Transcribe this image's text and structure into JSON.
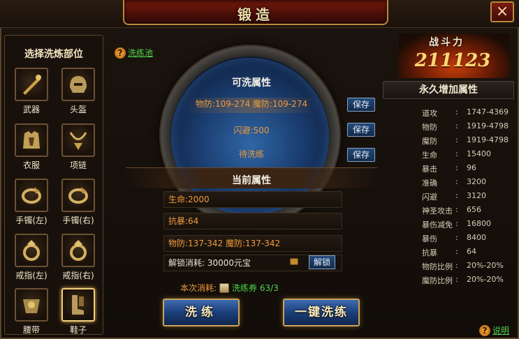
{
  "window": {
    "title": "锻造",
    "close_icon": "×"
  },
  "left_panel": {
    "title": "选择洗炼部位",
    "slots": [
      {
        "label": "武器",
        "icon": "weapon-icon"
      },
      {
        "label": "头盔",
        "icon": "helmet-icon"
      },
      {
        "label": "衣服",
        "icon": "armor-icon"
      },
      {
        "label": "项链",
        "icon": "necklace-icon"
      },
      {
        "label": "手镯(左)",
        "icon": "bracelet-icon"
      },
      {
        "label": "手镯(右)",
        "icon": "bracelet-icon"
      },
      {
        "label": "戒指(左)",
        "icon": "ring-icon"
      },
      {
        "label": "戒指(右)",
        "icon": "ring-icon"
      },
      {
        "label": "腰带",
        "icon": "belt-icon"
      },
      {
        "label": "鞋子",
        "icon": "boots-icon",
        "selected": true
      }
    ]
  },
  "help_pool": {
    "q": "?",
    "label": "洗练池"
  },
  "washable": {
    "title": "可洗属性",
    "rows": [
      {
        "text": "物防:109-274 魔防:109-274",
        "save": "保存"
      },
      {
        "text": "闪避:500",
        "save": "保存"
      },
      {
        "text": "待洗练",
        "save": "保存"
      }
    ]
  },
  "current": {
    "title": "当前属性",
    "rows": [
      "生命:2000",
      "抗暴:64",
      "物防:137-342 魔防:137-342"
    ],
    "unlock_text": "解锁消耗: 30000元宝",
    "unlock_button": "解锁"
  },
  "cost": {
    "label": "本次消耗:",
    "item": "洗练券 63/3"
  },
  "buttons": {
    "wash": "洗练",
    "one_click": "一键洗练"
  },
  "power": {
    "label": "战斗力",
    "value": "211123"
  },
  "permanent": {
    "title": "永久增加属性",
    "stats": [
      {
        "name": "道攻",
        "value": "1747-4369"
      },
      {
        "name": "物防",
        "value": "1919-4798"
      },
      {
        "name": "魔防",
        "value": "1919-4798"
      },
      {
        "name": "生命",
        "value": "15400"
      },
      {
        "name": "暴击",
        "value": "96"
      },
      {
        "name": "准确",
        "value": "3200"
      },
      {
        "name": "闪避",
        "value": "3120"
      },
      {
        "name": "神圣攻击",
        "value": "656"
      },
      {
        "name": "暴伤减免",
        "value": "16800"
      },
      {
        "name": "暴伤",
        "value": "8400"
      },
      {
        "name": "抗暴",
        "value": "64"
      },
      {
        "name": "物防比例",
        "value": "20%-20%"
      },
      {
        "name": "魔防比例",
        "value": "20%-20%"
      }
    ]
  },
  "help_explain": {
    "q": "?",
    "label": "说明"
  },
  "colors": {
    "orange_text": "#f09a3a",
    "link_green": "#4fd34a",
    "power_gold": "#ffd877"
  }
}
